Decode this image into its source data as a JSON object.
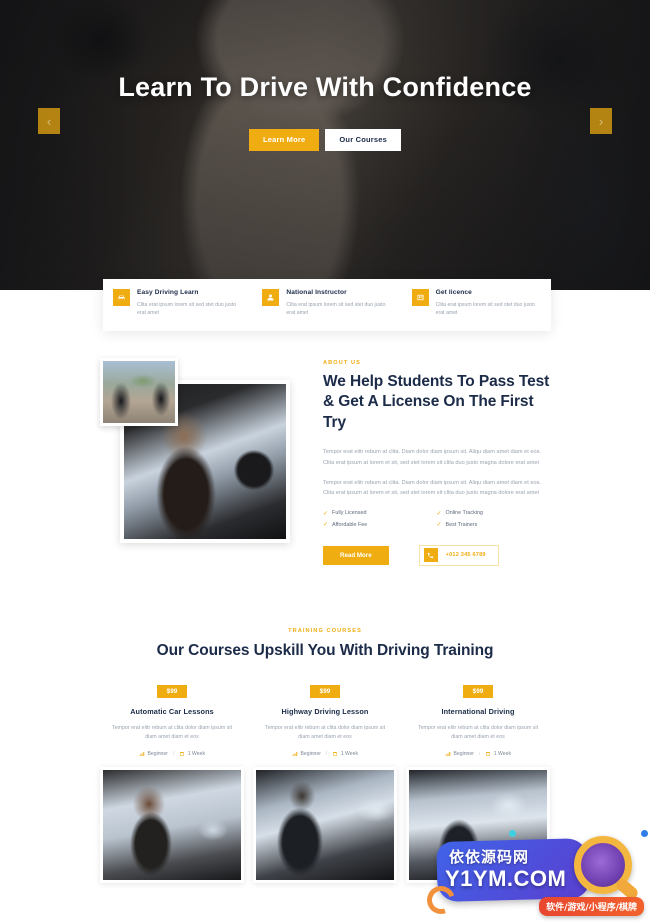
{
  "hero": {
    "title": "Learn To Drive With Confidence",
    "buttons": {
      "primary": "Learn More",
      "secondary": "Our Courses"
    },
    "arrows": {
      "prev": "‹",
      "next": "›"
    }
  },
  "features": [
    {
      "icon": "car-icon",
      "title": "Easy Driving Learn",
      "desc": "Clita erat ipsum lorem sit sed stet duo justo erat amet"
    },
    {
      "icon": "instructor-icon",
      "title": "National Instructor",
      "desc": "Clita erat ipsum lorem sit sed stet duo justo erat amet"
    },
    {
      "icon": "licence-card-icon",
      "title": "Get licence",
      "desc": "Clita erat ipsum lorem sit sed stet duo justo erat amet"
    }
  ],
  "about": {
    "eyebrow": "ABOUT US",
    "heading": "We Help Students To Pass Test & Get A License On The First Try",
    "paragraph1": "Tempor erat elitr rebum at clita. Diam dolor diam ipsum sit. Aliqu diam amet diam et eos. Clita erat ipsum at lorem et sit, sed stet lorem sit clita duo justo magna dolore erat amet",
    "paragraph2": "Tempor erat elitr rebum at clita. Diam dolor diam ipsum sit. Aliqu diam amet diam et eos. Clita erat ipsum at lorem et sit, sed stet lorem sit clita duo justo magna dolore erat amet",
    "checklist": [
      "Fully Licensed",
      "Online Tracking",
      "Affordable Fee",
      "Best Trainers"
    ],
    "read_more": "Read More",
    "phone": "+012 345 6789",
    "phone_icon": "phone-icon",
    "check_icon": "check-icon"
  },
  "courses": {
    "eyebrow": "TRAINING COURSES",
    "title": "Our Courses Upskill You With Driving Training",
    "items": [
      {
        "price": "$99",
        "name": "Automatic Car Lessons",
        "desc": "Tempor erat elitr rebum at clita dolor diam ipsum sit diam amet diam et eos",
        "level": "Beginner",
        "duration": "1 Week",
        "level_icon": "signal-bars-icon",
        "duration_icon": "calendar-icon",
        "separator": "/"
      },
      {
        "price": "$99",
        "name": "Highway Driving Lesson",
        "desc": "Tempor erat elitr rebum at clita dolor diam ipsum sit diam amet diam et eos",
        "level": "Beginner",
        "duration": "1 Week",
        "level_icon": "signal-bars-icon",
        "duration_icon": "calendar-icon",
        "separator": "/"
      },
      {
        "price": "$99",
        "name": "International Driving",
        "desc": "Tempor erat elitr rebum at clita dolor diam ipsum sit diam amet diam et eos",
        "level": "Beginner",
        "duration": "1 Week",
        "level_icon": "signal-bars-icon",
        "duration_icon": "calendar-icon",
        "separator": "/"
      }
    ]
  },
  "watermark": {
    "cn_name": "依依源码网",
    "domain": "Y1YM.COM",
    "tagline": "软件/游戏/小程序/棋牌"
  },
  "colors": {
    "accent": "#f0ad11",
    "heading": "#1b2b48",
    "body_text": "#9aa3b0",
    "hero_bg": "#1d1d1d"
  }
}
